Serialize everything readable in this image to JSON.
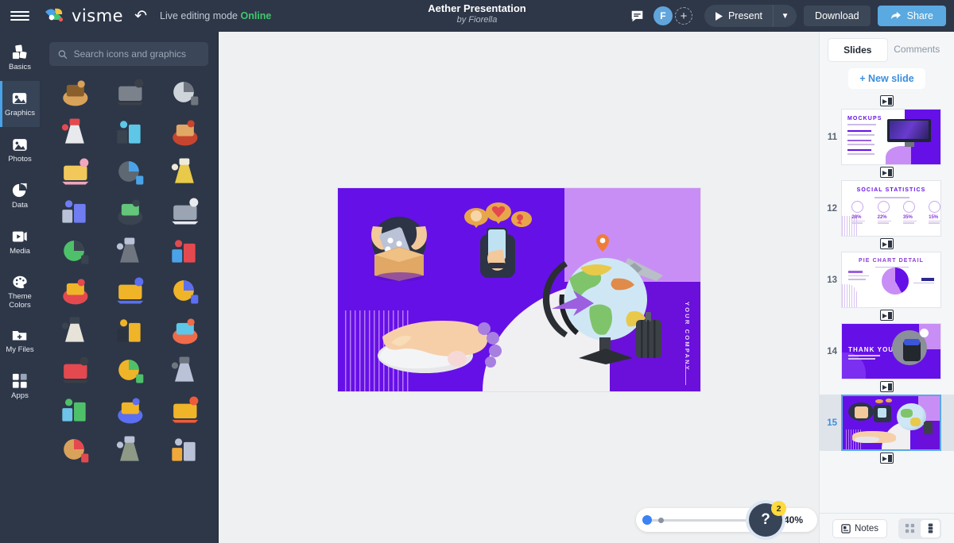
{
  "app": {
    "brand": "visme",
    "live_mode_label": "Live editing mode",
    "live_mode_status": "Online",
    "doc_title": "Aether Presentation",
    "doc_author": "by Fiorella",
    "hamburger_icon": "hamburger-menu-icon",
    "undo_icon": "undo-icon",
    "comment_icon": "comment-icon",
    "avatar_initial": "F",
    "add_collaborator_icon": "add-person-icon",
    "present_label": "Present",
    "present_caret_icon": "chevron-down-icon",
    "download_label": "Download",
    "share_label": "Share",
    "share_icon": "share-arrow-icon",
    "accent_blue": "#5aa9e0",
    "topbar_bg": "#2d3748",
    "online_green": "#42c76c"
  },
  "rail": {
    "items": [
      {
        "label": "Basics",
        "icon": "blocks-icon",
        "active": false
      },
      {
        "label": "Graphics",
        "icon": "graphics-icon",
        "active": true
      },
      {
        "label": "Photos",
        "icon": "photo-icon",
        "active": false
      },
      {
        "label": "Data",
        "icon": "pie-chart-icon",
        "active": false
      },
      {
        "label": "Media",
        "icon": "video-icon",
        "active": false
      },
      {
        "label": "Theme\nColors",
        "label_line1": "Theme",
        "label_line2": "Colors",
        "icon": "palette-icon",
        "active": false
      },
      {
        "label": "My Files",
        "icon": "folder-plus-icon",
        "active": false
      },
      {
        "label": "Apps",
        "icon": "apps-grid-icon",
        "active": false
      }
    ]
  },
  "graphics_panel": {
    "search": {
      "placeholder": "Search icons and graphics",
      "value": "",
      "icon": "search-icon"
    },
    "thumbnails": [
      "ruler-icon",
      "headphones-icon",
      "keyboard-icon",
      "first-aid-kit-icon",
      "laptop-icon",
      "sale-market-stand-icon",
      "piggy-bank-icon",
      "factory-crane-icon",
      "menorah-icon",
      "atom-microscope-icon",
      "recording-studio-icon",
      "dentist-chair-icon",
      "green-screen-icon",
      "office-cabinets-icon",
      "data-dashboard-icon",
      "magnet-coins-icon",
      "sales-funnel-icon",
      "review-stars-icon",
      "chess-board-icon",
      "umbrella-coins-icon",
      "growth-spiral-icon",
      "3d-printer-icon",
      "color-wheel-icon",
      "creative-commons-icon",
      "globe-travel-icon",
      "ladder-success-icon",
      "percent-growth-icon",
      "market-crates-icon",
      "garden-bench-icon",
      "padlock-icon"
    ]
  },
  "canvas": {
    "current_slide": {
      "company_text": "YOUR COMPANY",
      "background_color": "#6610e8",
      "lilac_color": "#c98ef5",
      "dark_purple_color": "#6b0fdb",
      "white_color": "#f0eff2",
      "elements": [
        "hands-unboxing-phone-illustration",
        "hand-holding-phone-reactions-illustration",
        "globe-airplane-suitcase-illustration",
        "hand-on-mouse-illustration",
        "vertical-stripes-decoration"
      ]
    },
    "zoom": {
      "value_label": "40%",
      "percent": 40
    },
    "help": {
      "icon": "question-mark-icon",
      "badge": "2"
    }
  },
  "right_panel": {
    "tabs": [
      {
        "label": "Slides",
        "active": true
      },
      {
        "label": "Comments",
        "active": false
      }
    ],
    "new_slide_label": "+ New slide",
    "insert_chip_icon": "insert-slide-icon",
    "slides": [
      {
        "number": "11",
        "title": "MOCKUPS",
        "kind": "mockups",
        "selected": false
      },
      {
        "number": "12",
        "title": "SOCIAL STATISTICS",
        "kind": "social-stats",
        "selected": false,
        "stats": [
          {
            "value": "28%"
          },
          {
            "value": "22%"
          },
          {
            "value": "35%"
          },
          {
            "value": "15%"
          }
        ]
      },
      {
        "number": "13",
        "title": "PIE CHART DETAIL",
        "kind": "pie-chart",
        "selected": false
      },
      {
        "number": "14",
        "title": "THANK YOU",
        "kind": "thank-you",
        "selected": false
      },
      {
        "number": "15",
        "title": "",
        "kind": "current",
        "selected": true
      }
    ],
    "bottom": {
      "notes_label": "Notes",
      "notes_icon": "notes-icon",
      "grid_view_icon": "grid-view-icon",
      "list_view_icon": "list-view-icon",
      "active_view": "list"
    }
  }
}
